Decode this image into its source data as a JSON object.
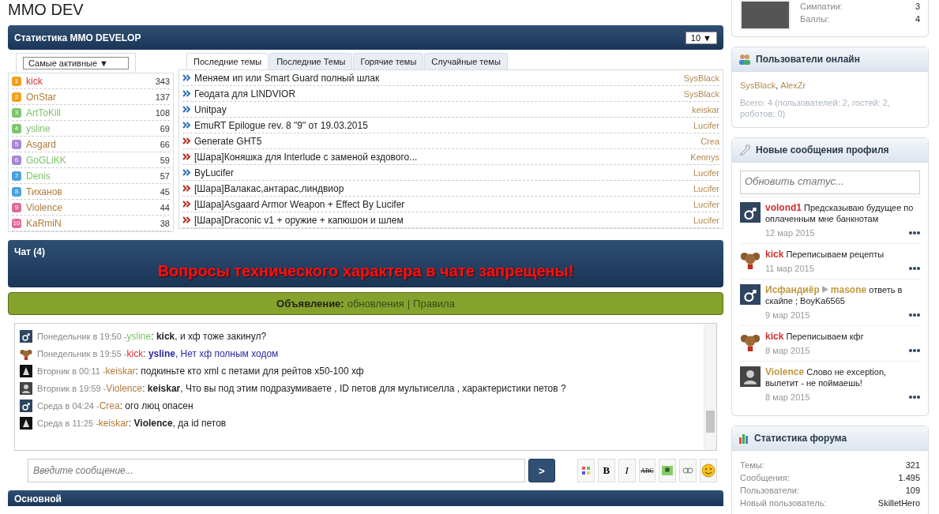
{
  "site_title": "MMO DEV",
  "stats": {
    "title": "Статистика MMO DEVELOP",
    "count_select": "10 ▼",
    "users_select": "Самые активные ▼",
    "users": [
      {
        "rank": "1",
        "name": "kick",
        "color": "#d03030",
        "count": "343"
      },
      {
        "rank": "2",
        "name": "OnStar",
        "color": "#b07a3a",
        "count": "137"
      },
      {
        "rank": "3",
        "name": "ArtToKill",
        "color": "#7cc46a",
        "count": "108"
      },
      {
        "rank": "4",
        "name": "ysline",
        "color": "#7cc46a",
        "count": "69"
      },
      {
        "rank": "5",
        "name": "Asgard",
        "color": "#b07a3a",
        "count": "66"
      },
      {
        "rank": "6",
        "name": "GoGLiKK",
        "color": "#7cc46a",
        "count": "59"
      },
      {
        "rank": "7",
        "name": "Denis",
        "color": "#7cc46a",
        "count": "57"
      },
      {
        "rank": "8",
        "name": "Тиханов",
        "color": "#b07a3a",
        "count": "45"
      },
      {
        "rank": "9",
        "name": "Violence",
        "color": "#b07a3a",
        "count": "44"
      },
      {
        "rank": "10",
        "name": "KaRmiN",
        "color": "#b07a3a",
        "count": "38"
      }
    ],
    "tabs": [
      {
        "label": "Последние темы",
        "selected": true
      },
      {
        "label": "Последние Темы",
        "selected": false
      },
      {
        "label": "Горячие темы",
        "selected": false
      },
      {
        "label": "Случайные темы",
        "selected": false
      }
    ],
    "topics": [
      {
        "kind": "normal",
        "title": "Меняем ип или Smart Guard полный шлак",
        "author": "SysBlack"
      },
      {
        "kind": "normal",
        "title": "Геодата для LINDVIOR",
        "author": "SysBlack"
      },
      {
        "kind": "normal",
        "title": "Unitpay",
        "author": "keiskar"
      },
      {
        "kind": "normal",
        "title": "EmuRT Epilogue rev. 8 \"9\" от 19.03.2015",
        "author": "Lucifer"
      },
      {
        "kind": "hot",
        "title": "Generate GHT5",
        "author": "Crea"
      },
      {
        "kind": "hot",
        "title": "[Шара]Коняшка для Interlude с заменой ездового...",
        "author": "Kennys"
      },
      {
        "kind": "normal",
        "title": "ByLucifer",
        "author": "Lucifer"
      },
      {
        "kind": "hot",
        "title": "[Шара]Валакас,антарас,линдвиор",
        "author": "Lucifer"
      },
      {
        "kind": "hot",
        "title": "[Шара]Asgaard Armor Weapon + Effect By Lucifer",
        "author": "Lucifer"
      },
      {
        "kind": "hot",
        "title": "[Шара]Draconic v1 + оружие + капюшон и шлем",
        "author": "Lucifer"
      }
    ]
  },
  "chat": {
    "title": "Чат (4)",
    "warning": "Вопросы технического характера в чате запрещены!",
    "announcement": {
      "label": "Объявление:",
      "link_1": "обновления",
      "separator": "|",
      "link_2": "Правила"
    },
    "messages": [
      {
        "kind": "male",
        "time": "Понедельник в 19:50 - ",
        "author": "ysline",
        "color": "#7cc46a",
        "text": ": **kick**, и хф тоже закинул?",
        "highlighted": false
      },
      {
        "kind": "cartoon",
        "time": "Понедельник в 19:55 - ",
        "author": "kick",
        "color": "#d03030",
        "text": ": **ysline**, Нет хф полным ходом",
        "highlighted": true
      },
      {
        "kind": "triangle",
        "time": "Вторник в 00:11 - ",
        "author": "keiskar",
        "color": "#b07a3a",
        "text": ": подкиньте кто xml с петами для рейтов x50-100 хф",
        "highlighted": false
      },
      {
        "kind": "silhouette",
        "time": "Вторник в 19:59 - ",
        "author": "Violence",
        "color": "#b07a3a",
        "text": ": **keiskar**, Что вы под этим подразумиваете , ID петов для мультиселла , характеристики петов ?",
        "highlighted": false
      },
      {
        "kind": "male",
        "time": "Среда в 04:24 - ",
        "author": "Crea",
        "color": "#b07a3a",
        "text": ": ого люц опасен",
        "highlighted": false
      },
      {
        "kind": "triangle",
        "time": "Среда в 11:25 - ",
        "author": "keiskar",
        "color": "#b07a3a",
        "text": ": **Violence**, да id петов",
        "highlighted": false
      }
    ],
    "input_placeholder": "Введите сообщение...",
    "send": ">",
    "toolbar": [
      "B",
      "I",
      "ABC"
    ]
  },
  "bottom_bar": {
    "title": "Основной"
  },
  "profile": {
    "stats": [
      {
        "label": "Симпатии:",
        "value": "3"
      },
      {
        "label": "Баллы:",
        "value": "4"
      }
    ]
  },
  "online": {
    "title": "Пользователи онлайн",
    "users": [
      {
        "name": "SysBlack",
        "separator": ","
      },
      {
        "name": "AlexZr"
      }
    ],
    "summary": "Всего: 4 (пользователей: 2, гостей: 2, роботов: 0)"
  },
  "profile_posts": {
    "title": "Новые сообщения профиля",
    "status_placeholder": "Обновить статус...",
    "posts": [
      {
        "kind": "male",
        "author": "volond1",
        "color": "#d03030",
        "text": "Предсказываю будущее по оплаченным мне банкнотам",
        "date": "12 мар 2015"
      },
      {
        "kind": "cartoon",
        "author": "kick",
        "color": "#d03030",
        "text": "Переписываем рецепты",
        "date": "11 мар 2015"
      },
      {
        "kind": "male",
        "author": "Исфандиёр",
        "color": "#c09a40",
        "target": "masone",
        "text": "ответь в скайпе ; BoyKa6565",
        "date": "9 мар 2015"
      },
      {
        "kind": "cartoon",
        "author": "kick",
        "color": "#d03030",
        "text": "Переписываем кфг",
        "date": "8 мар 2015"
      },
      {
        "kind": "silhouette",
        "author": "Violence",
        "color": "#c09a40",
        "text": "Слово не exception, вылетит - не поймаешь!",
        "date": "8 мар 2015"
      }
    ]
  },
  "forum_stats": {
    "title": "Статистика форума",
    "rows": [
      {
        "label": "Темы:",
        "value": "321"
      },
      {
        "label": "Сообщения:",
        "value": "1.495"
      },
      {
        "label": "Пользователи:",
        "value": "109"
      },
      {
        "label": "Новый пользователь:",
        "value": "SkilletHero"
      }
    ]
  }
}
